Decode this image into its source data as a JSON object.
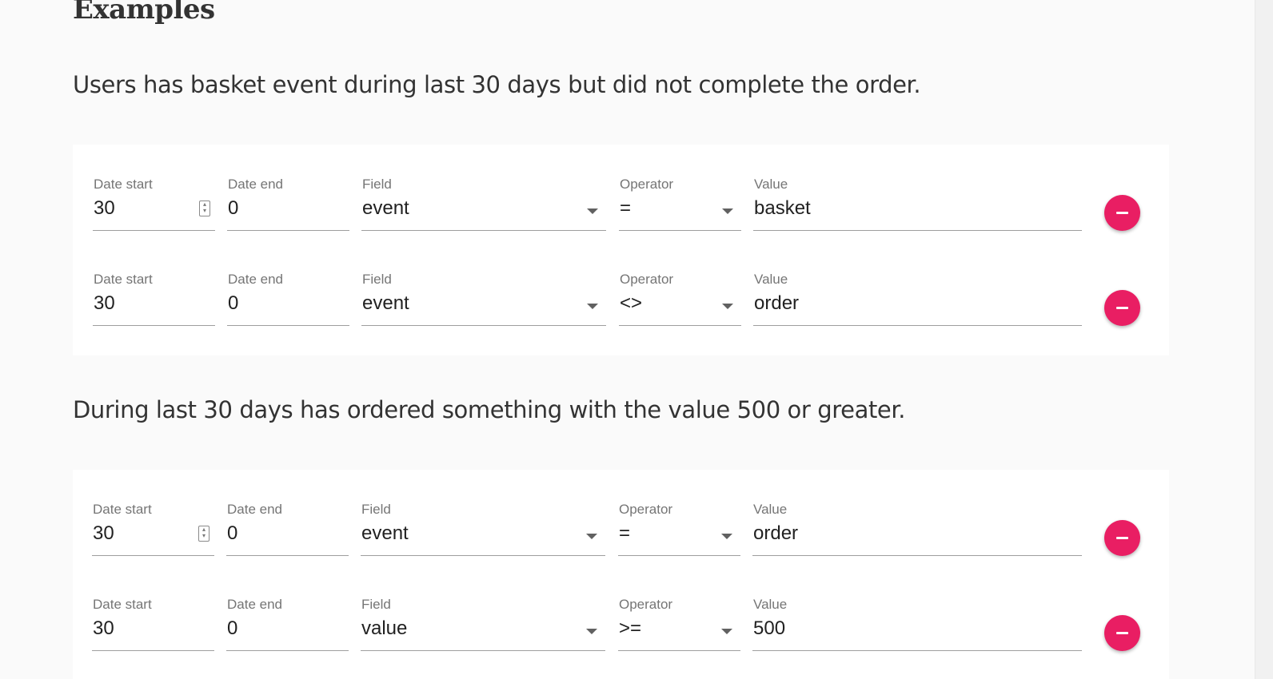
{
  "heading": "Examples",
  "examples": [
    {
      "description": "Users has basket event during last 30 days but did not complete the order.",
      "rows": [
        {
          "date_start_label": "Date start",
          "date_start": "30",
          "date_end_label": "Date end",
          "date_end": "0",
          "field_label": "Field",
          "field": "event",
          "operator_label": "Operator",
          "operator": "=",
          "value_label": "Value",
          "value": "basket"
        },
        {
          "date_start_label": "Date start",
          "date_start": "30",
          "date_end_label": "Date end",
          "date_end": "0",
          "field_label": "Field",
          "field": "event",
          "operator_label": "Operator",
          "operator": "<>",
          "value_label": "Value",
          "value": "order"
        }
      ]
    },
    {
      "description": "During last 30 days has ordered something with the value 500 or greater.",
      "rows": [
        {
          "date_start_label": "Date start",
          "date_start": "30",
          "date_end_label": "Date end",
          "date_end": "0",
          "field_label": "Field",
          "field": "event",
          "operator_label": "Operator",
          "operator": "=",
          "value_label": "Value",
          "value": "order"
        },
        {
          "date_start_label": "Date start",
          "date_start": "30",
          "date_end_label": "Date end",
          "date_end": "0",
          "field_label": "Field",
          "field": "value",
          "operator_label": "Operator",
          "operator": ">=",
          "value_label": "Value",
          "value": "500"
        }
      ]
    }
  ],
  "icons": {
    "remove": "remove-circle-icon",
    "dropdown": "arrow-drop-down-icon",
    "spinner": "number-spinner-icon"
  },
  "colors": {
    "accent": "#e91e63",
    "background": "#fafafa",
    "card": "#ffffff"
  }
}
